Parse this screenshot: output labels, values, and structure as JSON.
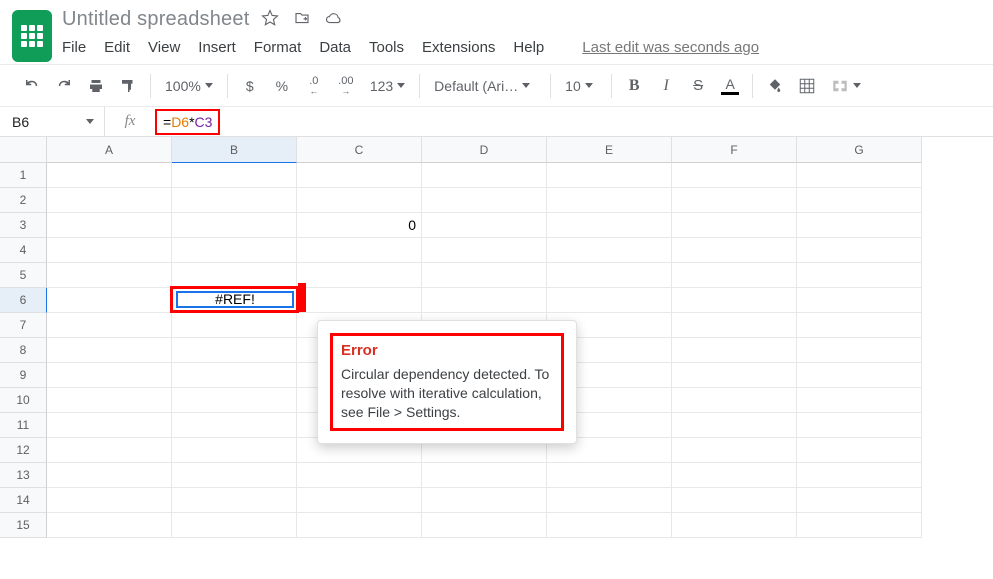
{
  "title": {
    "doc_name": "Untitled spreadsheet"
  },
  "menu": {
    "file": "File",
    "edit": "Edit",
    "view": "View",
    "insert": "Insert",
    "format": "Format",
    "data": "Data",
    "tools": "Tools",
    "extensions": "Extensions",
    "help": "Help",
    "last_edit": "Last edit was seconds ago"
  },
  "toolbar": {
    "zoom": "100%",
    "currency": "$",
    "percent": "%",
    "dec_decrease": ".0",
    "dec_increase": ".00",
    "number_format": "123",
    "font": "Default (Ari…",
    "font_size": "10",
    "bold": "B",
    "italic": "I",
    "strike": "S",
    "textcolor": "A"
  },
  "formula_bar": {
    "name_box": "B6",
    "fx": "fx",
    "formula_eq": "=",
    "formula_ref1": "D6",
    "formula_op": "*",
    "formula_ref2": "C3"
  },
  "columns": [
    "A",
    "B",
    "C",
    "D",
    "E",
    "F",
    "G"
  ],
  "rows": [
    "1",
    "2",
    "3",
    "4",
    "5",
    "6",
    "7",
    "8",
    "9",
    "10",
    "11",
    "12",
    "13",
    "14",
    "15"
  ],
  "cells": {
    "c3": "0",
    "b6": "#REF!"
  },
  "error": {
    "title": "Error",
    "message": "Circular dependency detected. To resolve with iterative calculation, see File > Settings."
  }
}
